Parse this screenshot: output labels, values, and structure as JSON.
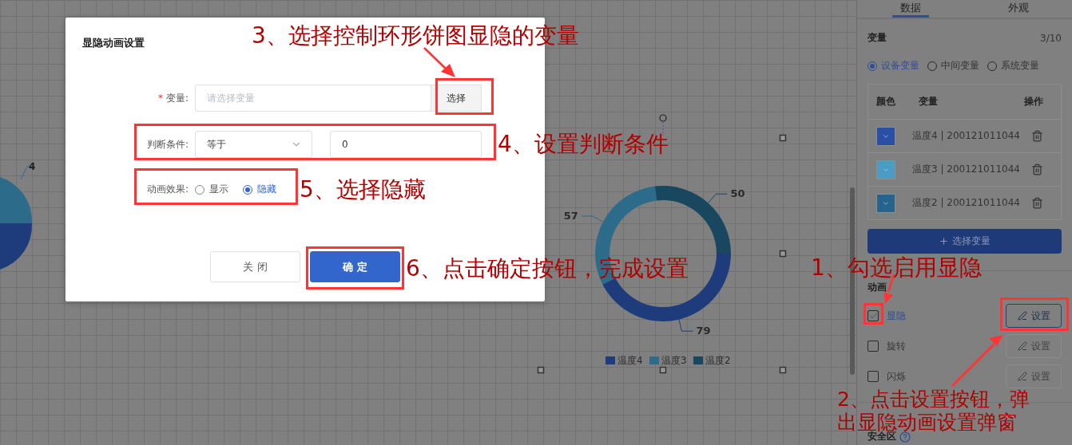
{
  "canvas": {
    "left_pie_label": "4",
    "donut": {
      "chart_data": {
        "type": "donut",
        "categories": [
          "温度4",
          "温度3",
          "温度2"
        ],
        "values": [
          79,
          57,
          50
        ],
        "data_labels": true,
        "legend": true
      },
      "slices": [
        {
          "color": "#1e3c7c"
        },
        {
          "color": "#2d6b8a"
        },
        {
          "color": "#18475f"
        }
      ]
    }
  },
  "dialog": {
    "title": "显隐动画设置",
    "variable": {
      "label": "变量:",
      "required_mark": "*",
      "placeholder": "请选择变量",
      "button": "选择"
    },
    "condition": {
      "label": "判断条件:",
      "operator": "等于",
      "value": "0"
    },
    "effect": {
      "label": "动画效果:",
      "options": [
        {
          "label": "显示",
          "selected": false
        },
        {
          "label": "隐藏",
          "selected": true
        }
      ]
    },
    "buttons": [
      {
        "label": "关 闭",
        "kind": "secondary"
      },
      {
        "label": "确 定",
        "kind": "primary"
      }
    ]
  },
  "panel": {
    "tabs": [
      {
        "label": "数据",
        "selected": true
      },
      {
        "label": "外观",
        "selected": false
      }
    ],
    "variables": {
      "title": "变量",
      "count": "3/10",
      "types": [
        {
          "label": "设备变量",
          "selected": true
        },
        {
          "label": "中间变量",
          "selected": false
        },
        {
          "label": "系统变量",
          "selected": false
        }
      ],
      "columns": [
        "颜色",
        "变量",
        "操作"
      ],
      "rows": [
        {
          "color": "#2b4fa5",
          "variable": "温度4 | 200121011044"
        },
        {
          "color": "#4a9cc7",
          "variable": "温度3 | 200121011044"
        },
        {
          "color": "#27648c",
          "variable": "温度2 | 200121011044"
        }
      ],
      "add_button": "选择变量"
    },
    "animation": {
      "title": "动画",
      "items": [
        {
          "label": "显隐",
          "checked": true,
          "button": "设置"
        },
        {
          "label": "旋转",
          "checked": false,
          "button": "设置"
        },
        {
          "label": "闪烁",
          "checked": false,
          "button": "设置"
        }
      ]
    },
    "safe_zone": {
      "title": "安全区"
    }
  },
  "annotations": [
    "3、选择控制环形饼图显隐的变量",
    "4、设置判断条件",
    "5、选择隐藏",
    "6、点击确定按钮，完成设置",
    "1、勾选启用显隐",
    "2、点击设置按钮，弹出显隐动画设置弹窗"
  ]
}
